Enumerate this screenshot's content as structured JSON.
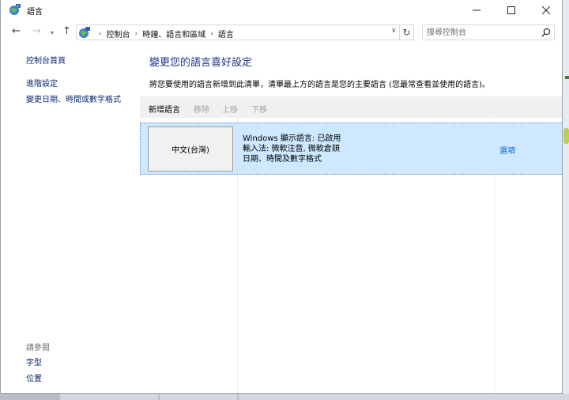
{
  "window": {
    "title": "語言"
  },
  "address": {
    "breadcrumbs": [
      "控制台",
      "時鐘、語言和區域",
      "語言"
    ],
    "search_placeholder": "搜尋控制台"
  },
  "sidebar": {
    "links": [
      "控制台首頁",
      "進階設定",
      "變更日期、時間或數字格式"
    ],
    "see_also_heading": "請參閱",
    "see_also_links": [
      "字型",
      "位置"
    ]
  },
  "main": {
    "title": "變更您的語言喜好設定",
    "description": "將您要使用的語言新增到此清單，清單最上方的語言是您的主要語言 (您最常查看並使用的語言)。",
    "toolbar": {
      "add": "新增語言",
      "remove": "移除",
      "move_up": "上移",
      "move_down": "下移"
    },
    "languages": [
      {
        "name": "中文(台灣)",
        "details": [
          "Windows 顯示語言: 已啟用",
          "輸入法: 微軟注音, 微軟倉頡",
          "日期、時間及數字格式"
        ],
        "options_label": "選項"
      }
    ]
  },
  "colors": {
    "link": "#0b2a6f",
    "title_blue": "#1e3287",
    "selection": "#cde8ff",
    "options_link": "#0066cc"
  }
}
